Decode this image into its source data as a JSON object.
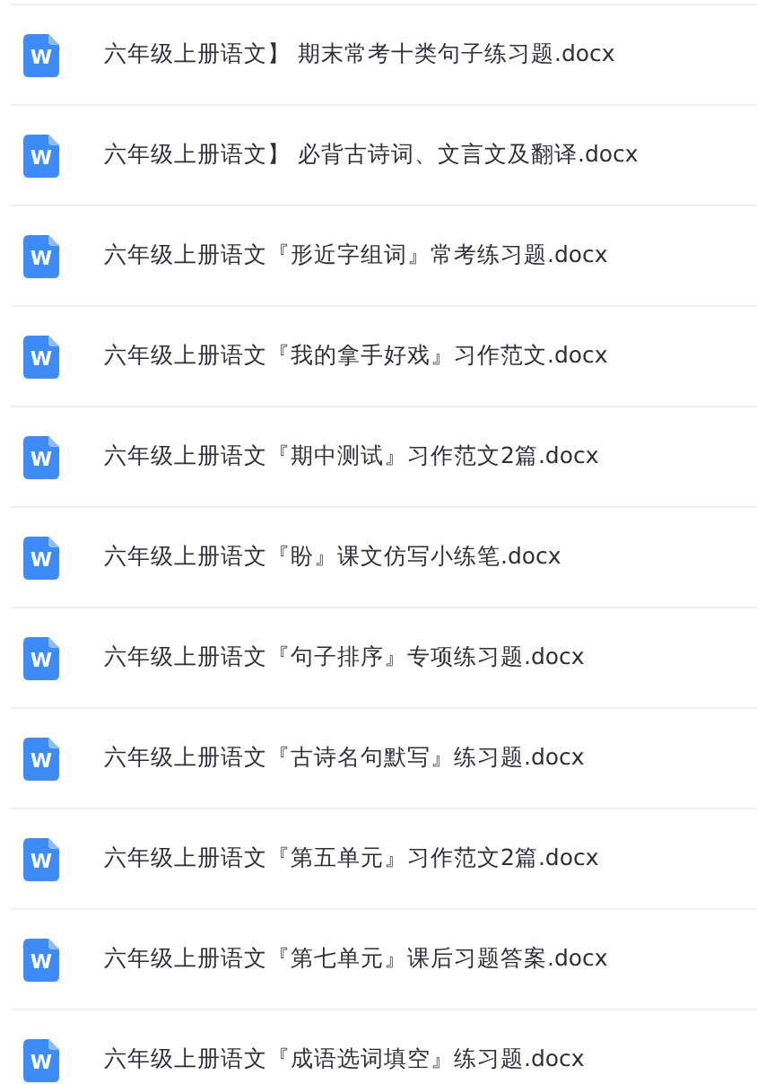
{
  "files": [
    {
      "icon_letter": "W",
      "name": "六年级上册语文】 期末常考十类句子练习题.docx"
    },
    {
      "icon_letter": "W",
      "name": "六年级上册语文】 必背古诗词、文言文及翻译.docx"
    },
    {
      "icon_letter": "W",
      "name": "六年级上册语文『形近字组词』常考练习题.docx"
    },
    {
      "icon_letter": "W",
      "name": "六年级上册语文『我的拿手好戏』习作范文.docx"
    },
    {
      "icon_letter": "W",
      "name": "六年级上册语文『期中测试』习作范文2篇.docx"
    },
    {
      "icon_letter": "W",
      "name": "六年级上册语文『盼』课文仿写小练笔.docx"
    },
    {
      "icon_letter": "W",
      "name": "六年级上册语文『句子排序』专项练习题.docx"
    },
    {
      "icon_letter": "W",
      "name": "六年级上册语文『古诗名句默写』练习题.docx"
    },
    {
      "icon_letter": "W",
      "name": "六年级上册语文『第五单元』习作范文2篇.docx"
    },
    {
      "icon_letter": "W",
      "name": "六年级上册语文『第七单元』课后习题答案.docx"
    },
    {
      "icon_letter": "W",
      "name": "六年级上册语文『成语选词填空』练习题.docx"
    }
  ]
}
